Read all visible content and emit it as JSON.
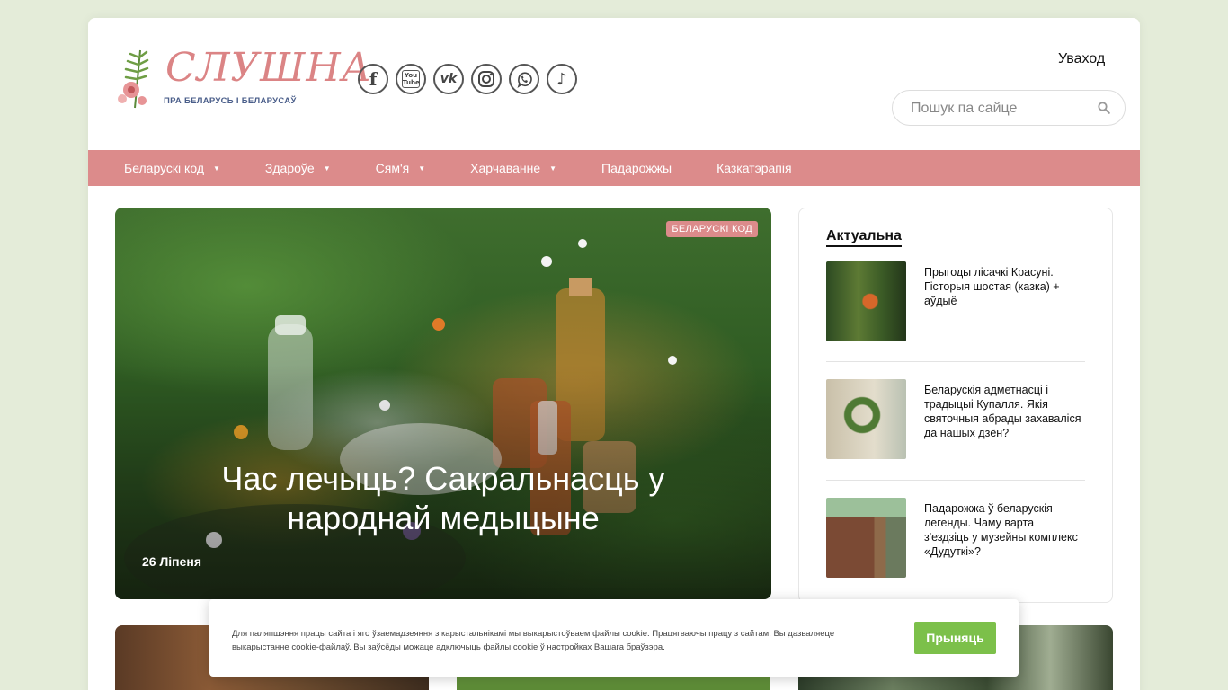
{
  "header": {
    "logo_title": "СЛУШНА",
    "logo_subtitle": "ПРА БЕЛАРУСЬ І БЕЛАРУСАЎ",
    "login_label": "Уваход",
    "search_placeholder": "Пошук па сайце",
    "socials": [
      {
        "icon": "facebook-icon",
        "glyph": "f"
      },
      {
        "icon": "youtube-icon",
        "glyph": "You Tube"
      },
      {
        "icon": "vk-icon",
        "glyph": "vk"
      },
      {
        "icon": "instagram-icon",
        "glyph": ""
      },
      {
        "icon": "viber-icon",
        "glyph": ""
      },
      {
        "icon": "tiktok-icon",
        "glyph": "♪"
      }
    ]
  },
  "nav": {
    "items": [
      {
        "label": "Беларускі код",
        "dropdown": true
      },
      {
        "label": "Здароўе",
        "dropdown": true
      },
      {
        "label": "Сям'я",
        "dropdown": true
      },
      {
        "label": "Харчаванне",
        "dropdown": true
      },
      {
        "label": "Падарожжы",
        "dropdown": false
      },
      {
        "label": "Казкатэрапія",
        "dropdown": false
      }
    ],
    "caret": "▼"
  },
  "hero": {
    "badge": "БЕЛАРУСКІ КОД",
    "title": "Час лечыць? Сакральнасць у народнай медыцыне",
    "date": "26 Ліпеня"
  },
  "sidebar": {
    "heading": "Актуальна",
    "items": [
      {
        "title": "Прыгоды лісачкі Красуні. Гісторыя шостая (казка) + аўдыё"
      },
      {
        "title": "Беларускія адметнасці і традыцыі Купалля. Якія святочныя абрады захаваліся да нашых дзён?"
      },
      {
        "title": "Падарожжа ў беларускія легенды. Чаму варта з'ездзіць у музейны комплекс «Дудуткі»?"
      }
    ]
  },
  "cookie": {
    "text": "Для паляпшэння працы сайта і яго ўзаемадзеяння з карыстальнікамі мы выкарыстоўваем файлы cookie. Працягваючы працу з сайтам, Вы дазваляеце выкарыстанне cookie-файлаў. Вы заўсёды можаце адключыць файлы cookie ў настройках Вашага браўзэра.",
    "accept_label": "Прыняць"
  },
  "colors": {
    "accent": "#dc8b8b",
    "background": "#e4ecd9",
    "cookie_button": "#7cc04a",
    "logo_text": "#db8485",
    "logo_subtitle": "#4a5e8a"
  }
}
